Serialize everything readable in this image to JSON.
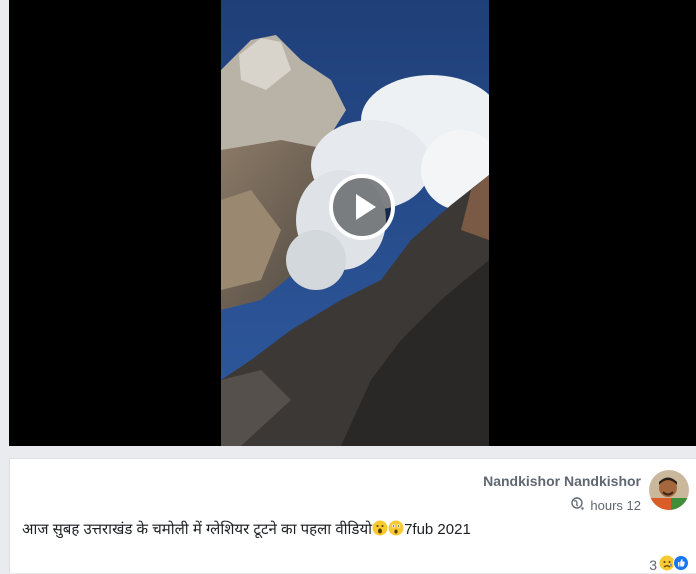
{
  "video": {
    "play_label": "Play"
  },
  "post": {
    "author": "Nandkishor Nandkishor",
    "time": "hours 12",
    "text_main": "आज सुबह उत्तराखंड के चमोली में ग्लेशियर टूटने का पहला वीडियो",
    "text_date": "7fub 2021",
    "text_emojis": [
      "surprised-face",
      "astonished-face"
    ],
    "reaction_count": "3",
    "reactions": [
      "sad-reaction",
      "like-reaction"
    ]
  },
  "colors": {
    "like_blue": "#1877f2",
    "emoji_yellow": "#f7c932"
  }
}
